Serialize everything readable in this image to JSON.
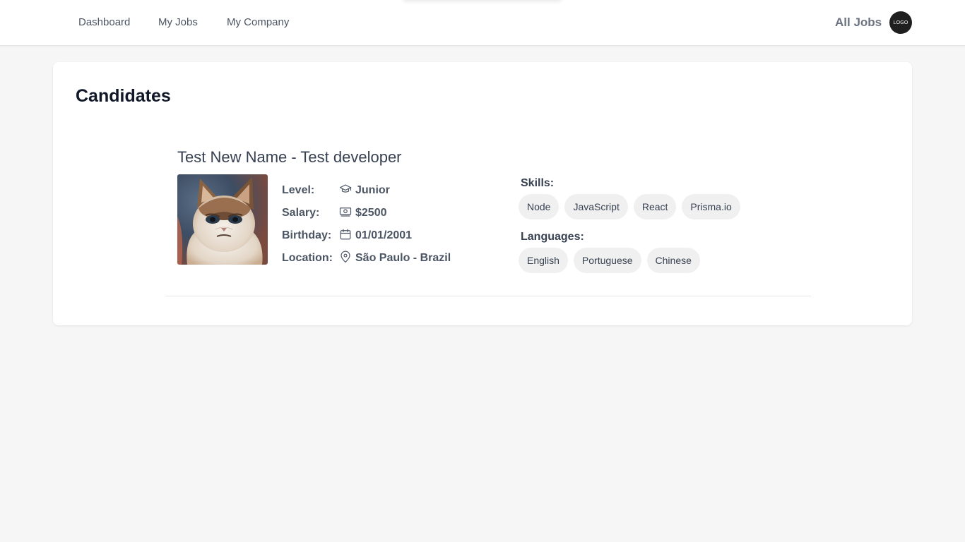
{
  "nav": {
    "links": [
      "Dashboard",
      "My Jobs",
      "My Company"
    ],
    "all_jobs": "All Jobs",
    "logo_text": "LOGO"
  },
  "page": {
    "title": "Candidates"
  },
  "candidate": {
    "name": "Test New Name - Test developer",
    "level_label": "Level:",
    "level_value": "Junior",
    "salary_label": "Salary:",
    "salary_value": "$2500",
    "birthday_label": "Birthday:",
    "birthday_value": "01/01/2001",
    "location_label": "Location:",
    "location_value": "São Paulo - Brazil",
    "skills_label": "Skills:",
    "skills": [
      "Node",
      "JavaScript",
      "React",
      "Prisma.io"
    ],
    "languages_label": "Languages:",
    "languages": [
      "English",
      "Portuguese",
      "Chinese"
    ]
  },
  "icons": {
    "level": "graduation-cap-icon",
    "salary": "banknote-icon",
    "birthday": "calendar-icon",
    "location": "map-pin-icon"
  },
  "colors": {
    "background": "#f6f6f6",
    "card": "#ffffff",
    "chip": "#f0f0f0",
    "logo": "#1f1f1f"
  }
}
